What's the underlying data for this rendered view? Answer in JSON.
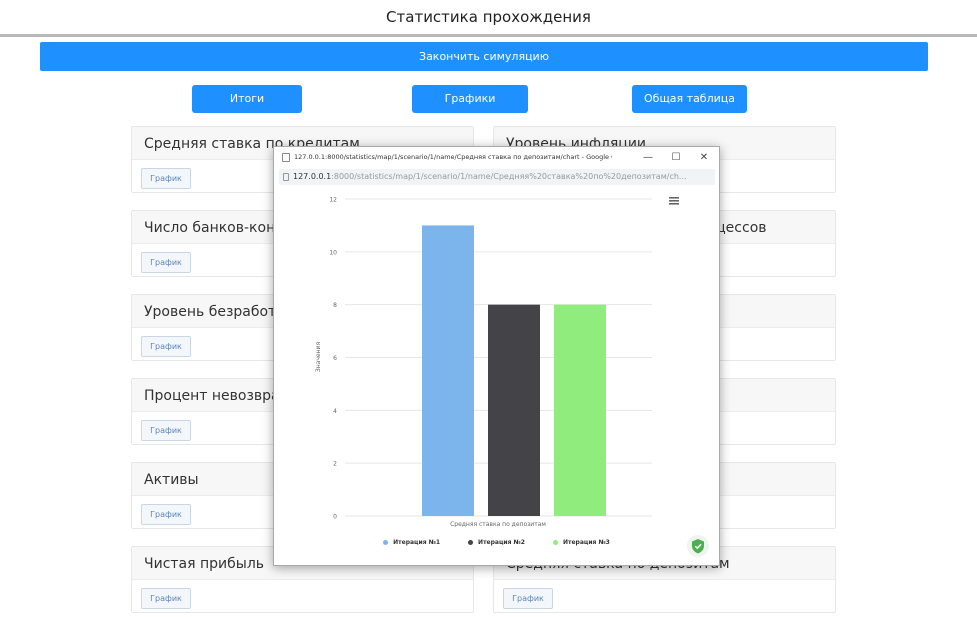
{
  "page": {
    "title": "Статистика прохождения"
  },
  "actions": {
    "finish_label": "Закончить симуляцию"
  },
  "nav": {
    "results": "Итоги",
    "charts": "Графики",
    "table": "Общая таблица"
  },
  "cards": [
    {
      "title": "Средняя ставка по кредитам",
      "button": "График"
    },
    {
      "title": "Уровень инфляции",
      "button": "График"
    },
    {
      "title": "Число банков-конкурентов",
      "button": "График"
    },
    {
      "title": "Число успешных бизнес-процессов",
      "button": "График"
    },
    {
      "title": "Уровень безработицы",
      "button": "График"
    },
    {
      "title": "",
      "button": "График"
    },
    {
      "title": "Процент невозврата кредитов",
      "button": "График"
    },
    {
      "title": "",
      "button": "График"
    },
    {
      "title": "Активы",
      "button": "График"
    },
    {
      "title": "",
      "button": "График"
    },
    {
      "title": "Чистая прибыль",
      "button": "График"
    },
    {
      "title": "Средняя ставка по депозитам",
      "button": "График"
    }
  ],
  "popup": {
    "window_title": "127.0.0.1:8000/statistics/map/1/scenario/1/name/Средняя ставка по депозитам/chart - Google Ch...",
    "address_host": "127.0.0.1",
    "address_path": ":8000/statistics/map/1/scenario/1/name/Средняя%20ставка%20по%20депозитам/ch...",
    "controls": {
      "minimize": "—",
      "maximize": "☐",
      "close": "✕"
    },
    "menu_icon": "hamburger-menu-icon",
    "shield_icon": "shield-check-icon"
  },
  "chart_data": {
    "type": "bar",
    "categories": [
      "Средняя ставка по депозитам"
    ],
    "series": [
      {
        "name": "Итерация №1",
        "values": [
          11
        ],
        "color": "#7cb5ec"
      },
      {
        "name": "Итерация №2",
        "values": [
          8
        ],
        "color": "#434348"
      },
      {
        "name": "Итерация №3",
        "values": [
          8
        ],
        "color": "#90ed7d"
      }
    ],
    "ylim": [
      0,
      12
    ],
    "yticks": [
      "0",
      "2",
      "4",
      "6",
      "8",
      "10",
      "12"
    ],
    "ylabel": "Значения",
    "xlabel": "Средняя ставка по депозитам",
    "grid": true,
    "legend": "bottom"
  }
}
